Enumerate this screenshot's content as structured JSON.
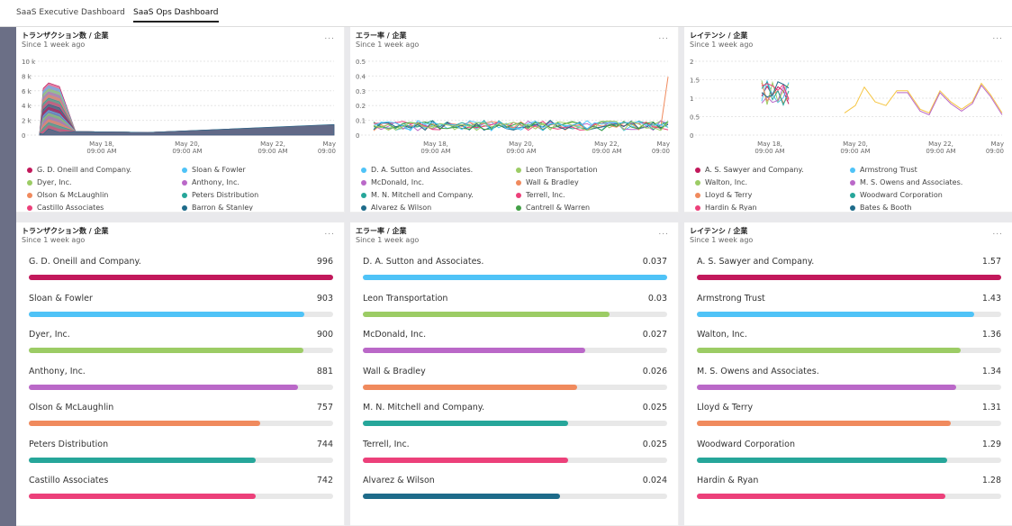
{
  "tabs": [
    {
      "label": "SaaS Executive Dashboard",
      "active": false
    },
    {
      "label": "SaaS Ops Dashboard",
      "active": true
    }
  ],
  "top_panels": [
    {
      "title": "トランザクション数 / 企業",
      "subtitle": "Since 1 week ago",
      "menu": "...",
      "y_ticks": [
        "10 k",
        "8 k",
        "6 k",
        "4 k",
        "2 k",
        "0"
      ],
      "x_ticks": [
        [
          "May 18,",
          "09:00 AM"
        ],
        [
          "May 20,",
          "09:00 AM"
        ],
        [
          "May 22,",
          "09:00 AM"
        ],
        [
          "May",
          "09:00"
        ]
      ],
      "legend": [
        {
          "label": "G. D. Oneill and Company.",
          "color": "#c2185b"
        },
        {
          "label": "Sloan & Fowler",
          "color": "#4fc3f7"
        },
        {
          "label": "Dyer, Inc.",
          "color": "#9ccc65"
        },
        {
          "label": "Anthony, Inc.",
          "color": "#ba68c8"
        },
        {
          "label": "Olson & McLaughlin",
          "color": "#f08a5d"
        },
        {
          "label": "Peters Distribution",
          "color": "#26a69a"
        },
        {
          "label": "Castillo Associates",
          "color": "#ec407a"
        },
        {
          "label": "Barron & Stanley",
          "color": "#1e6b8a"
        }
      ]
    },
    {
      "title": "エラー率 / 企業",
      "subtitle": "Since 1 week ago",
      "menu": "...",
      "y_ticks": [
        "0.5",
        "0.4",
        "0.3",
        "0.2",
        "0.1",
        "0"
      ],
      "x_ticks": [
        [
          "May 18,",
          "09:00 AM"
        ],
        [
          "May 20,",
          "09:00 AM"
        ],
        [
          "May 22,",
          "09:00 AM"
        ],
        [
          "May",
          "09:00"
        ]
      ],
      "legend": [
        {
          "label": "D. A. Sutton and Associates.",
          "color": "#4fc3f7"
        },
        {
          "label": "Leon Transportation",
          "color": "#9ccc65"
        },
        {
          "label": "McDonald, Inc.",
          "color": "#ba68c8"
        },
        {
          "label": "Wall & Bradley",
          "color": "#f08a5d"
        },
        {
          "label": "M. N. Mitchell and Company.",
          "color": "#26a69a"
        },
        {
          "label": "Terrell, Inc.",
          "color": "#ec407a"
        },
        {
          "label": "Alvarez & Wilson",
          "color": "#1e6b8a"
        },
        {
          "label": "Cantrell & Warren",
          "color": "#43a047"
        }
      ]
    },
    {
      "title": "レイテンシ / 企業",
      "subtitle": "Since 1 week ago",
      "menu": "...",
      "y_ticks": [
        "2",
        "1.5",
        "1",
        "0.5",
        "0"
      ],
      "x_ticks": [
        [
          "May 18,",
          "09:00 AM"
        ],
        [
          "May 20,",
          "09:00 AM"
        ],
        [
          "May 22,",
          "09:00 AM"
        ],
        [
          "May",
          "09:00"
        ]
      ],
      "legend": [
        {
          "label": "A. S. Sawyer and Company.",
          "color": "#c2185b"
        },
        {
          "label": "Armstrong Trust",
          "color": "#4fc3f7"
        },
        {
          "label": "Walton, Inc.",
          "color": "#9ccc65"
        },
        {
          "label": "M. S. Owens and Associates.",
          "color": "#ba68c8"
        },
        {
          "label": "Lloyd & Terry",
          "color": "#f08a5d"
        },
        {
          "label": "Woodward Corporation",
          "color": "#26a69a"
        },
        {
          "label": "Hardin & Ryan",
          "color": "#ec407a"
        },
        {
          "label": "Bates & Booth",
          "color": "#1e6b8a"
        }
      ]
    }
  ],
  "bottom_panels": [
    {
      "title": "トランザクション数 / 企業",
      "subtitle": "Since 1 week ago",
      "menu": "...",
      "max": 996,
      "rows": [
        {
          "name": "G. D. Oneill and Company.",
          "value": "996",
          "num": 996,
          "color": "#c2185b"
        },
        {
          "name": "Sloan & Fowler",
          "value": "903",
          "num": 903,
          "color": "#4fc3f7"
        },
        {
          "name": "Dyer, Inc.",
          "value": "900",
          "num": 900,
          "color": "#9ccc65"
        },
        {
          "name": "Anthony, Inc.",
          "value": "881",
          "num": 881,
          "color": "#ba68c8"
        },
        {
          "name": "Olson & McLaughlin",
          "value": "757",
          "num": 757,
          "color": "#f08a5d"
        },
        {
          "name": "Peters Distribution",
          "value": "744",
          "num": 744,
          "color": "#26a69a"
        },
        {
          "name": "Castillo Associates",
          "value": "742",
          "num": 742,
          "color": "#ec407a"
        }
      ]
    },
    {
      "title": "エラー率 / 企業",
      "subtitle": "Since 1 week ago",
      "menu": "...",
      "max": 0.037,
      "rows": [
        {
          "name": "D. A. Sutton and Associates.",
          "value": "0.037",
          "num": 0.037,
          "color": "#4fc3f7"
        },
        {
          "name": "Leon Transportation",
          "value": "0.03",
          "num": 0.03,
          "color": "#9ccc65"
        },
        {
          "name": "McDonald, Inc.",
          "value": "0.027",
          "num": 0.027,
          "color": "#ba68c8"
        },
        {
          "name": "Wall & Bradley",
          "value": "0.026",
          "num": 0.026,
          "color": "#f08a5d"
        },
        {
          "name": "M. N. Mitchell and Company.",
          "value": "0.025",
          "num": 0.025,
          "color": "#26a69a"
        },
        {
          "name": "Terrell, Inc.",
          "value": "0.025",
          "num": 0.025,
          "color": "#ec407a"
        },
        {
          "name": "Alvarez & Wilson",
          "value": "0.024",
          "num": 0.024,
          "color": "#1e6b8a"
        }
      ]
    },
    {
      "title": "レイテンシ / 企業",
      "subtitle": "Since 1 week ago",
      "menu": "...",
      "max": 1.57,
      "rows": [
        {
          "name": "A. S. Sawyer and Company.",
          "value": "1.57",
          "num": 1.57,
          "color": "#c2185b"
        },
        {
          "name": "Armstrong Trust",
          "value": "1.43",
          "num": 1.43,
          "color": "#4fc3f7"
        },
        {
          "name": "Walton, Inc.",
          "value": "1.36",
          "num": 1.36,
          "color": "#9ccc65"
        },
        {
          "name": "M. S. Owens and Associates.",
          "value": "1.34",
          "num": 1.34,
          "color": "#ba68c8"
        },
        {
          "name": "Lloyd & Terry",
          "value": "1.31",
          "num": 1.31,
          "color": "#f08a5d"
        },
        {
          "name": "Woodward Corporation",
          "value": "1.29",
          "num": 1.29,
          "color": "#26a69a"
        },
        {
          "name": "Hardin & Ryan",
          "value": "1.28",
          "num": 1.28,
          "color": "#ec407a"
        }
      ]
    }
  ]
}
